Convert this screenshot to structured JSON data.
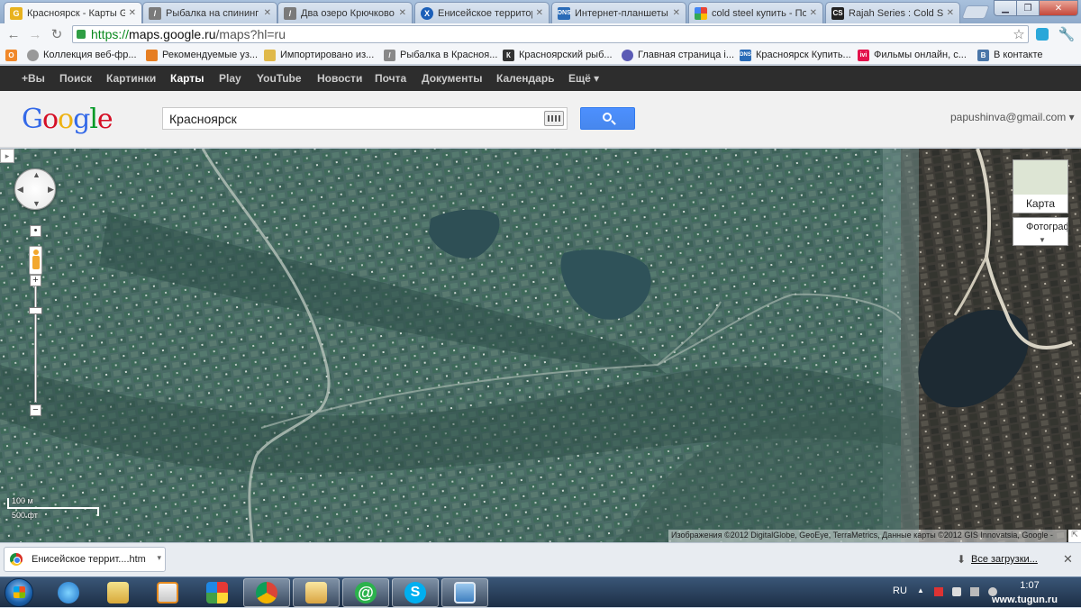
{
  "browser": {
    "tabs": [
      {
        "title": "Красноярск - Карты G",
        "active": true,
        "favicon": "google-maps-icon",
        "color": "#e8b21e"
      },
      {
        "title": "Рыбалка на спининг -",
        "active": false,
        "favicon": "fishing-icon",
        "color": "#7a7a7a"
      },
      {
        "title": "Два озеро Крючково -",
        "active": false,
        "favicon": "fishing-icon",
        "color": "#7a7a7a"
      },
      {
        "title": "Енисейское территор",
        "active": false,
        "favicon": "enisei-icon",
        "color": "#1b5fb8"
      },
      {
        "title": "Интернет-планшеты |",
        "active": false,
        "favicon": "dns-icon",
        "color": "#2a6bb7"
      },
      {
        "title": "cold steel купить - Пои",
        "active": false,
        "favicon": "google-icon",
        "color": "#3b8f3b"
      },
      {
        "title": "Rajah Series : Cold Stee",
        "active": false,
        "favicon": "cold-steel-icon",
        "color": "#222222"
      }
    ],
    "url_https": "https://",
    "url_domain": "maps.google.ru",
    "url_path": "/maps?hl=ru",
    "bookmarks": [
      {
        "label": "Коллекция веб-фр...",
        "icon": "web-collection-icon",
        "color": "#999999"
      },
      {
        "label": "Рекомендуемые уз...",
        "icon": "recommended-icon",
        "color": "#e67e22"
      },
      {
        "label": "Импортировано из...",
        "icon": "folder-icon",
        "color": "#e0b94a"
      },
      {
        "label": "Рыбалка в Красноя...",
        "icon": "fishing-icon",
        "color": "#888888"
      },
      {
        "label": "Красноярский рыб...",
        "icon": "fish-club-icon",
        "color": "#333333"
      },
      {
        "label": "Главная страница i...",
        "icon": "home-page-icon",
        "color": "#5b5bb5"
      },
      {
        "label": "Красноярск Купить...",
        "icon": "dns-icon",
        "color": "#2a6bb7"
      },
      {
        "label": "Фильмы онлайн, с...",
        "icon": "ivi-icon",
        "color": "#e3124b"
      },
      {
        "label": "В контакте",
        "icon": "vk-icon",
        "color": "#4a76a8"
      }
    ]
  },
  "gbar": {
    "items": [
      "+Вы",
      "Поиск",
      "Картинки",
      "Карты",
      "Play",
      "YouTube",
      "Новости",
      "Почта",
      "Документы",
      "Календарь",
      "Ещё ▾"
    ],
    "active_index": 3
  },
  "header": {
    "search_value": "Красноярск",
    "account": "papushinva@gmail.com ▾"
  },
  "map": {
    "scale_metric": "100 м",
    "scale_imperial": "500 фт",
    "type_map_label": "Карта",
    "type_photo_label": "Фотограф",
    "attribution": "Изображения ©2012 DigitalGlobe, GeoEye, TerraMetrics, Данные карты ©2012 GIS Innovatsia, Google -"
  },
  "download": {
    "filename": "Енисейское террит....htm",
    "show_all": "Все загрузки..."
  },
  "taskbar": {
    "lang": "RU",
    "time": "1:07",
    "watermark": "www.tugun.ru"
  }
}
